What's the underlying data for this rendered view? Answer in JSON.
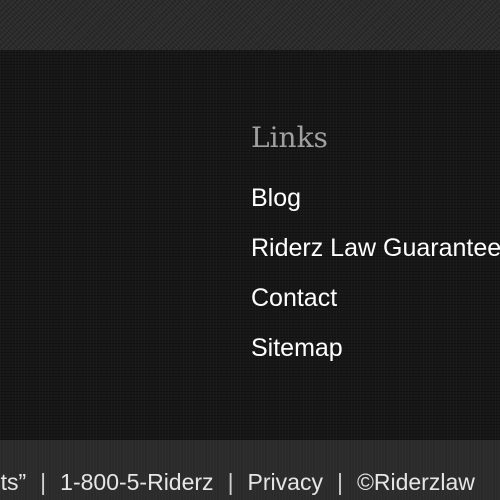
{
  "footer": {
    "links_heading": "Links",
    "links": [
      {
        "label": "Blog"
      },
      {
        "label": "Riderz Law Guarantee"
      },
      {
        "label": "Contact"
      },
      {
        "label": "Sitemap"
      }
    ]
  },
  "bottom_bar": {
    "tagline_fragment": "ists”",
    "phone": "1-800-5-Riderz",
    "privacy": "Privacy",
    "copyright_fragment": "©Riderzlaw",
    "separator": "|"
  },
  "colors": {
    "page_background": "#111111",
    "heading_color": "#a0a0a0",
    "link_color": "#ffffff",
    "bottom_bar_background": "#2b2b2b"
  }
}
